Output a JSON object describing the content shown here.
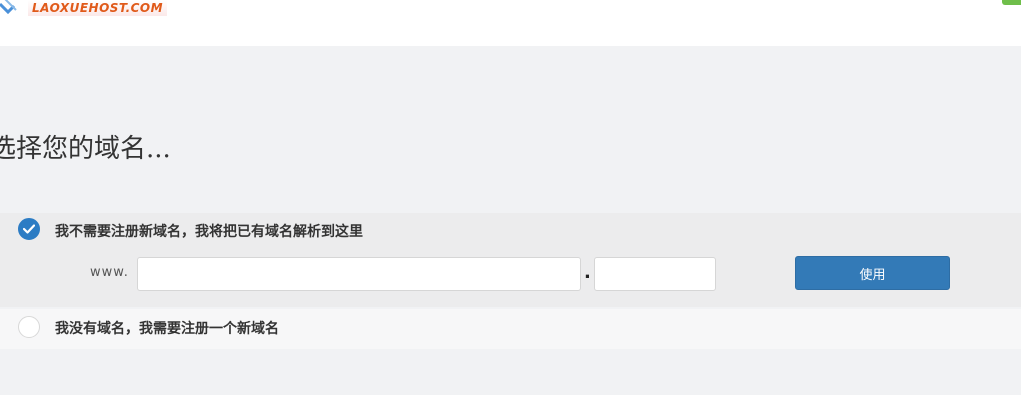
{
  "header": {
    "logo_text": "LAOXUEHOST.COM"
  },
  "heading": "选择您的域名...",
  "options": {
    "use_existing": {
      "label": "我不需要注册新域名，我将把已有域名解析到这里",
      "checked": true,
      "www_prefix": "www.",
      "sld_value": "",
      "separator": ".",
      "tld_value": "",
      "button_label": "使用"
    },
    "register_new": {
      "label": "我没有域名，我需要注册一个新域名",
      "checked": false
    }
  },
  "colors": {
    "accent": "#337ab7",
    "radio_checked": "#2c7cc4",
    "status_green": "#6fbe4a",
    "logo_text": "#e05a1a"
  }
}
